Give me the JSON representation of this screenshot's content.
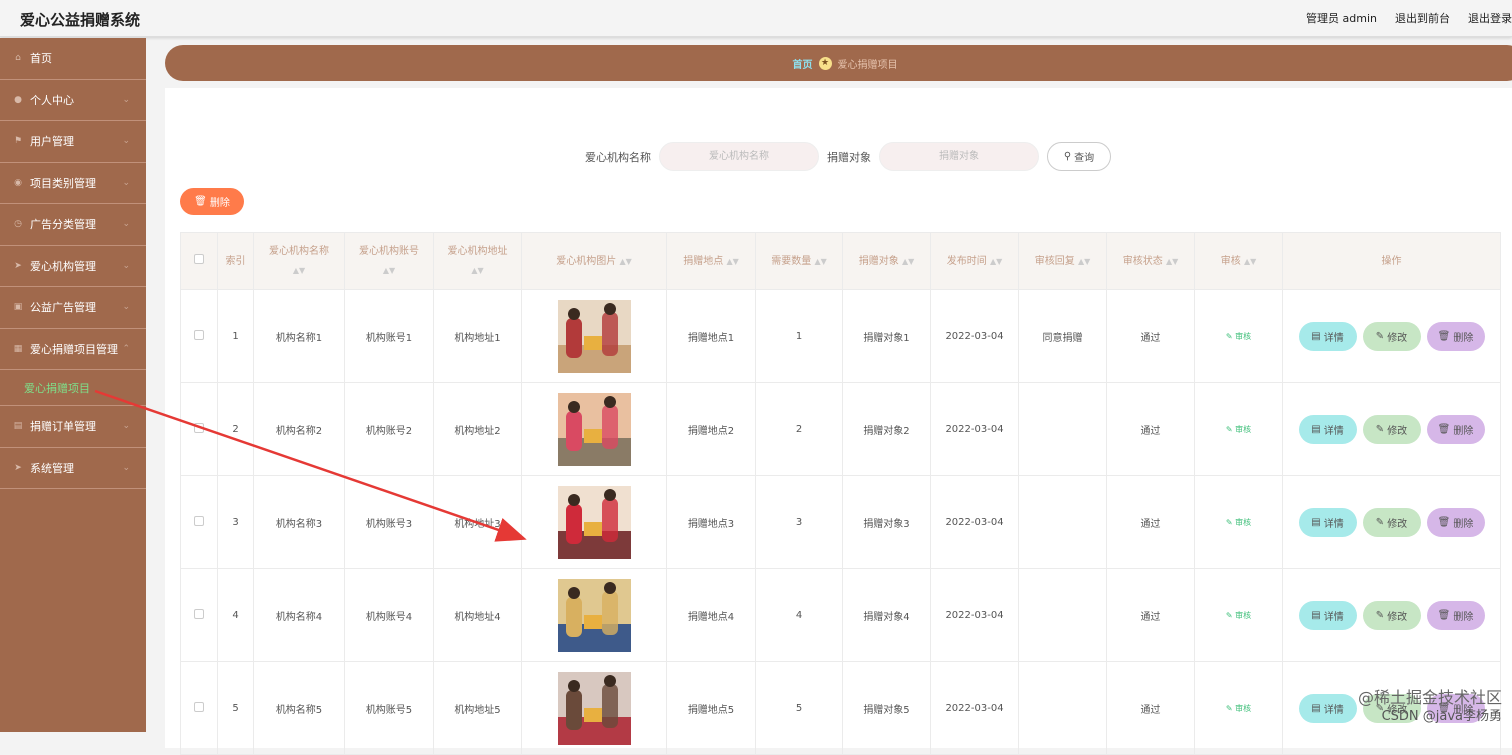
{
  "app": {
    "title": "爱心公益捐赠系统",
    "admin": "管理员 admin",
    "back_front": "退出到前台",
    "logout": "退出登录"
  },
  "sidebar": {
    "items": [
      {
        "label": "首页",
        "icon": "home-icon"
      },
      {
        "label": "个人中心",
        "icon": "user-icon"
      },
      {
        "label": "用户管理",
        "icon": "flag-icon"
      },
      {
        "label": "项目类别管理",
        "icon": "pin-icon"
      },
      {
        "label": "广告分类管理",
        "icon": "clock-icon"
      },
      {
        "label": "爱心机构管理",
        "icon": "send-icon"
      },
      {
        "label": "公益广告管理",
        "icon": "box-icon"
      },
      {
        "label": "爱心捐赠项目管理",
        "icon": "grid-icon"
      },
      {
        "label": "捐赠订单管理",
        "icon": "doc-icon"
      },
      {
        "label": "系统管理",
        "icon": "send-icon"
      }
    ],
    "active_sub": "爱心捐赠项目"
  },
  "breadcrumb": {
    "home": "首页",
    "current": "爱心捐赠项目"
  },
  "search": {
    "org_label": "爱心机构名称",
    "org_placeholder": "爱心机构名称",
    "target_label": "捐赠对象",
    "target_placeholder": "捐赠对象",
    "query_button": "查询"
  },
  "delete_button": "删除",
  "table": {
    "headers": [
      "索引",
      "爱心机构名称",
      "爱心机构账号",
      "爱心机构地址",
      "爱心机构图片",
      "捐赠地点",
      "需要数量",
      "捐赠对象",
      "发布时间",
      "审核回复",
      "审核状态",
      "审核",
      "操作"
    ],
    "rows": [
      {
        "index": "1",
        "name": "机构名称1",
        "account": "机构账号1",
        "address": "机构地址1",
        "place": "捐赠地点1",
        "qty": "1",
        "target": "捐赠对象1",
        "time": "2022-03-04",
        "reply": "同意捐赠",
        "status": "通过"
      },
      {
        "index": "2",
        "name": "机构名称2",
        "account": "机构账号2",
        "address": "机构地址2",
        "place": "捐赠地点2",
        "qty": "2",
        "target": "捐赠对象2",
        "time": "2022-03-04",
        "reply": "",
        "status": "通过"
      },
      {
        "index": "3",
        "name": "机构名称3",
        "account": "机构账号3",
        "address": "机构地址3",
        "place": "捐赠地点3",
        "qty": "3",
        "target": "捐赠对象3",
        "time": "2022-03-04",
        "reply": "",
        "status": "通过"
      },
      {
        "index": "4",
        "name": "机构名称4",
        "account": "机构账号4",
        "address": "机构地址4",
        "place": "捐赠地点4",
        "qty": "4",
        "target": "捐赠对象4",
        "time": "2022-03-04",
        "reply": "",
        "status": "通过"
      },
      {
        "index": "5",
        "name": "机构名称5",
        "account": "机构账号5",
        "address": "机构地址5",
        "place": "捐赠地点5",
        "qty": "5",
        "target": "捐赠对象5",
        "time": "2022-03-04",
        "reply": "",
        "status": "通过"
      }
    ],
    "audit_label": "审核",
    "detail_label": "详情",
    "edit_label": "修改",
    "remove_label": "删除"
  },
  "colors": {
    "brand": "#a0694c",
    "accent": "#ff7b4a",
    "active_sub": "#7ee08a",
    "arrow": "#e53935"
  },
  "watermark": {
    "line1": "@稀土掘金技术社区",
    "line2": "CSDN @java李杨勇"
  }
}
